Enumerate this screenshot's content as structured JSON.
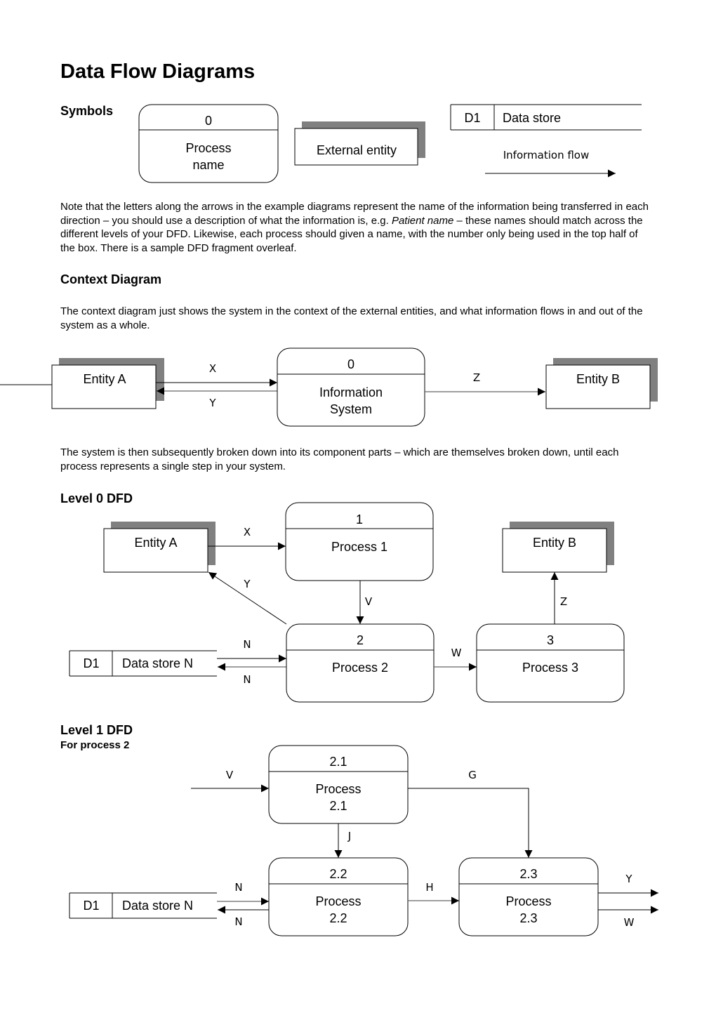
{
  "document": {
    "title": "Data Flow Diagrams",
    "sections": {
      "symbols": {
        "heading": "Symbols",
        "process": {
          "number": "0",
          "name_line1": "Process",
          "name_line2": "name"
        },
        "external_entity": {
          "label": "External entity"
        },
        "data_store": {
          "id": "D1",
          "label": "Data store"
        },
        "information_flow": {
          "label": "Information flow"
        }
      },
      "note": {
        "text_before_italic": "Note that the letters along the arrows in the example diagrams represent the name of the information being transferred in each direction – you should use a description of what the information is, e.g. ",
        "italic": "Patient name –",
        "text_after_italic": " these names should match across the different levels of your DFD.  Likewise, each process should given a name, with the number only being used in the top half of the box.  There is a sample DFD fragment overleaf."
      },
      "context": {
        "heading": "Context Diagram",
        "paragraph": "The context diagram just shows the system in the context of the external entities, and what information flows in and out of the system as a whole.",
        "entity_a": "Entity A",
        "entity_b": "Entity B",
        "process": {
          "number": "0",
          "name_line1": "Information",
          "name_line2": "System"
        },
        "flows": {
          "x": "X",
          "y": "Y",
          "z": "Z"
        }
      },
      "breakdown": {
        "paragraph": "The system is then subsequently broken down into its component parts – which are themselves broken down, until each process represents a single step in your system."
      },
      "level0": {
        "heading": "Level 0 DFD",
        "entity_a": "Entity A",
        "entity_b": "Entity B",
        "process1": {
          "number": "1",
          "name": "Process 1"
        },
        "process2": {
          "number": "2",
          "name": "Process 2"
        },
        "process3": {
          "number": "3",
          "name": "Process 3"
        },
        "data_store": {
          "id": "D1",
          "label": "Data store N"
        },
        "flows": {
          "x": "X",
          "y": "Y",
          "v": "V",
          "z": "Z",
          "n_in": "N",
          "n_out": "N",
          "w": "W"
        }
      },
      "level1": {
        "heading": "Level 1 DFD",
        "subheading": "For process 2",
        "process21": {
          "number": "2.1",
          "name_line1": "Process",
          "name_line2": "2.1"
        },
        "process22": {
          "number": "2.2",
          "name_line1": "Process",
          "name_line2": "2.2"
        },
        "process23": {
          "number": "2.3",
          "name_line1": "Process",
          "name_line2": "2.3"
        },
        "data_store": {
          "id": "D1",
          "label": "Data store N"
        },
        "flows": {
          "v": "V",
          "g": "G",
          "j": "J",
          "n_in": "N",
          "n_out": "N",
          "h": "H",
          "y": "Y",
          "w": "W"
        }
      }
    },
    "colors": {
      "ink": "#000000",
      "shadow": "#808080",
      "grey_line": "#666666"
    }
  }
}
